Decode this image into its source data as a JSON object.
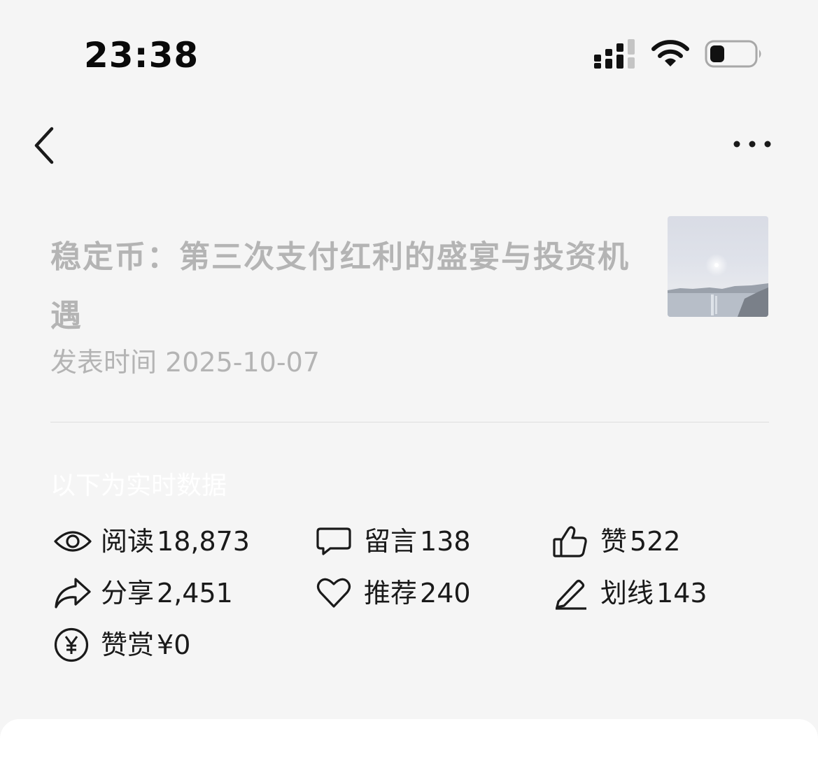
{
  "status_bar": {
    "time": "23:38"
  },
  "article": {
    "title": "稳定币：第三次支付红利的盛宴与投资机遇",
    "publish_time": "发表时间 2025-10-07"
  },
  "realtime_note": "以下为实时数据",
  "stats": {
    "read": {
      "label": "阅读",
      "value": "18,873",
      "icon": "eye-icon"
    },
    "comment": {
      "label": "留言",
      "value": "138",
      "icon": "comment-icon"
    },
    "like": {
      "label": "赞",
      "value": "522",
      "icon": "thumbs-up-icon"
    },
    "share": {
      "label": "分享",
      "value": "2,451",
      "icon": "share-icon"
    },
    "recommend": {
      "label": "推荐",
      "value": "240",
      "icon": "heart-icon"
    },
    "underline": {
      "label": "划线",
      "value": "143",
      "icon": "pen-icon"
    },
    "reward": {
      "label": "赞赏",
      "value": "¥0",
      "icon": "yuan-icon"
    }
  },
  "colors": {
    "background": "#f5f5f5",
    "muted_text": "#b4b4b4",
    "text": "#1a1a1a"
  }
}
